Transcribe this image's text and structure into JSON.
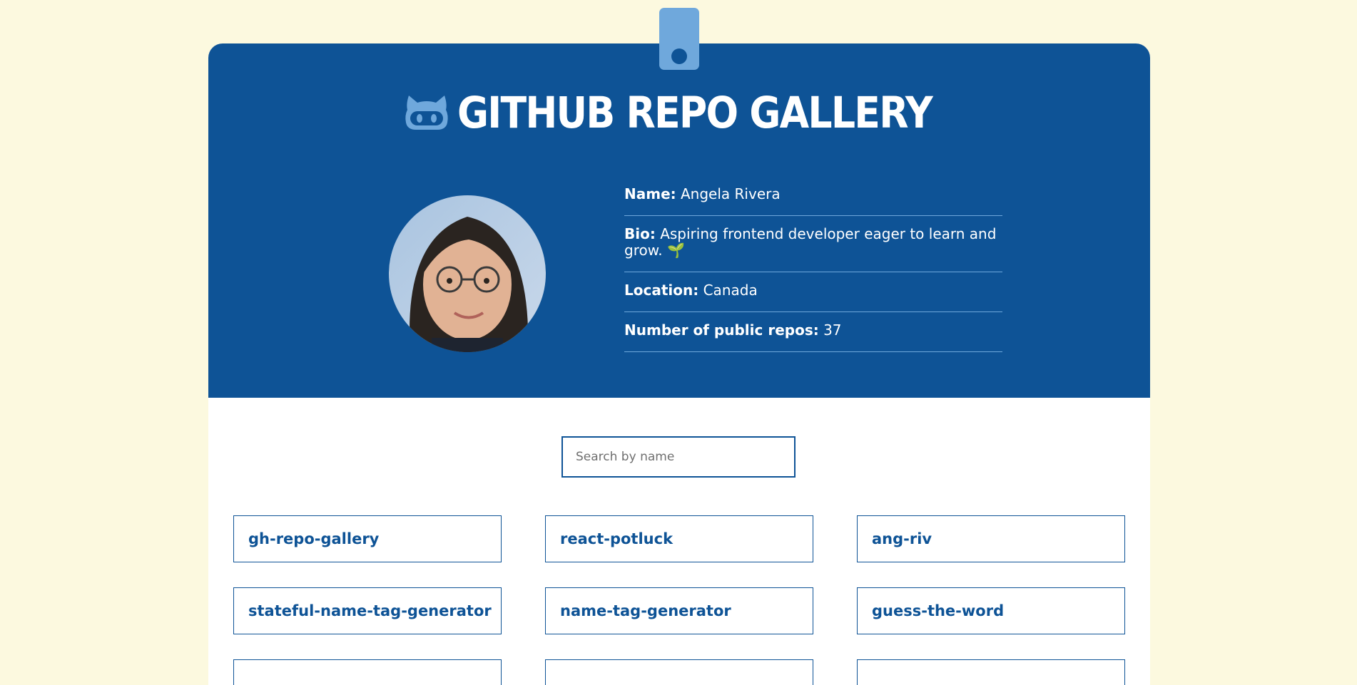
{
  "header": {
    "title": "GITHUB REPO GALLERY",
    "logo_icon": "octocat-icon"
  },
  "profile": {
    "name_label": "Name:",
    "name": "Angela Rivera",
    "bio_label": "Bio:",
    "bio": "Aspiring frontend developer eager to learn and grow. 🌱",
    "location_label": "Location:",
    "location": "Canada",
    "repos_label": "Number of public repos:",
    "repos_count": "37"
  },
  "search": {
    "placeholder": "Search by name"
  },
  "repos": [
    "gh-repo-gallery",
    "react-potluck",
    "ang-riv",
    "stateful-name-tag-generator",
    "name-tag-generator",
    "guess-the-word"
  ],
  "colors": {
    "background": "#fcf9df",
    "primary": "#0e5396",
    "accent": "#6fa8dc",
    "card": "#ffffff"
  }
}
